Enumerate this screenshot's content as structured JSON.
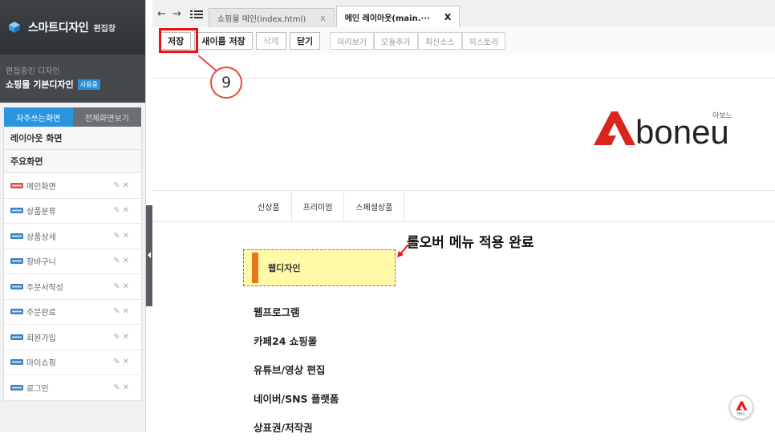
{
  "sidebar": {
    "app_title": "스마트디자인",
    "mode_label": "편집창",
    "current_caption": "편집중인 디자인",
    "current_design": "쇼핑몰 기본디자인",
    "current_badge": "사용중",
    "tabs": [
      {
        "label": "자주쓰는화면",
        "active": true
      },
      {
        "label": "전체화면보기",
        "active": false
      }
    ],
    "sections": [
      "레이아웃 화면",
      "주요화면"
    ],
    "pages": [
      "메인화면",
      "상품분류",
      "상품상세",
      "장바구니",
      "주문서작성",
      "주문완료",
      "회원가입",
      "마이쇼핑",
      "로그인"
    ],
    "item_action_icons": [
      "pencil-icon",
      "close-icon"
    ]
  },
  "tabbar": {
    "nav_arrows": "← →",
    "tabs": [
      {
        "label": "쇼핑몰 메인(index.html)",
        "active": false,
        "close": "x"
      },
      {
        "label": "메인 레이아웃(main.···",
        "active": true,
        "close": "X"
      }
    ]
  },
  "toolbar": {
    "buttons": [
      "저장",
      "새이름 저장",
      "삭제",
      "닫기"
    ],
    "tools": [
      "미리보기",
      "모듈추가",
      "최신소스",
      "히스토리"
    ]
  },
  "annotation": {
    "step_number": "9",
    "note": "롤오버 메뉴 적용 완료",
    "highlight_color": "#e11111"
  },
  "preview": {
    "brand_name": "boneu",
    "brand_korean": "아보느",
    "menu": [
      "신상품",
      "프리미엄",
      "스페셜상품"
    ],
    "hovered_item": "웹디자인",
    "nav_items": [
      "웹프로그램",
      "카페24 쇼핑몰",
      "유튜브/영상 편집",
      "네이버/SNS 플랫폼",
      "상표권/저작권"
    ],
    "fab_label": "아보느",
    "colors": {
      "accent": "#e8761e",
      "hover_bg": "#fffaa8",
      "brand_red": "#d9261c"
    }
  }
}
